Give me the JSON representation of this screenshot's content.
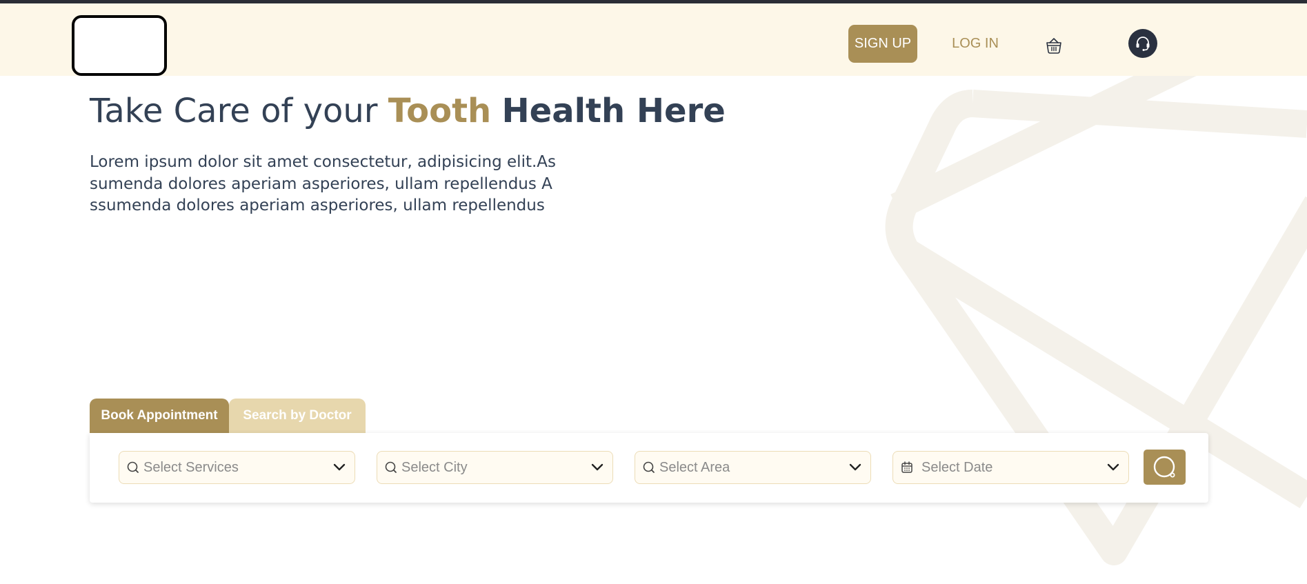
{
  "colors": {
    "accent": "#a98f56",
    "accent_light": "#e7d7ad",
    "header_bg": "#fdf7e8",
    "heading": "#334155",
    "dark": "#2a3140"
  },
  "header": {
    "signup_label": "SIGN UP",
    "login_label": "LOG IN",
    "cart_icon": "cart-icon",
    "support_icon": "headset-icon"
  },
  "hero": {
    "title_part1": "Take Care of your",
    "title_accent": "Tooth",
    "title_part2": "Health Here",
    "description": "Lorem ipsum dolor sit amet consectetur, adipisicing elit.Assumenda dolores aperiam asperiores, ullam repellendus Assumenda dolores aperiam asperiores, ullam repellendus"
  },
  "booking": {
    "tabs": [
      {
        "label": "Book Appointment",
        "active": true
      },
      {
        "label": "Search by Doctor",
        "active": false
      }
    ],
    "fields": [
      {
        "placeholder": "Select Services",
        "icon": "search-icon"
      },
      {
        "placeholder": "Select City",
        "icon": "search-icon"
      },
      {
        "placeholder": "Select Area",
        "icon": "search-icon"
      },
      {
        "placeholder": "Select Date",
        "icon": "calendar-icon"
      }
    ],
    "search_button_icon": "search-icon"
  }
}
